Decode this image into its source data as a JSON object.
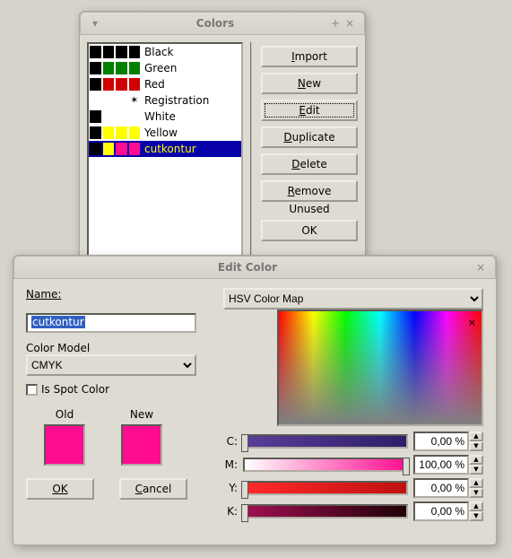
{
  "colors_window": {
    "title": "Colors",
    "buttons": {
      "import": "Import",
      "new": "New",
      "edit": "Edit",
      "duplicate": "Duplicate",
      "delete": "Delete",
      "remove_unused": "Remove Unused",
      "ok": "OK"
    },
    "items": [
      {
        "name": "Black",
        "swatches": [
          "#000000",
          "#000000",
          "#000000",
          "#000000"
        ]
      },
      {
        "name": "Green",
        "swatches": [
          "#000000",
          "#008000",
          "#008000",
          "#008000"
        ]
      },
      {
        "name": "Red",
        "swatches": [
          "#000000",
          "#d00000",
          "#d00000",
          "#d00000"
        ]
      },
      {
        "name": "Registration",
        "swatches": [
          "#ffffff",
          "#ffffff",
          "#ffffff",
          "reg"
        ]
      },
      {
        "name": "White",
        "swatches": [
          "#000000",
          "#ffffff",
          "#ffffff",
          "#ffffff"
        ]
      },
      {
        "name": "Yellow",
        "swatches": [
          "#000000",
          "#ffff00",
          "#ffff00",
          "#ffff00"
        ]
      },
      {
        "name": "cutkontur",
        "swatches": [
          "#000000",
          "#ffff00",
          "#ff0c90",
          "#ff0c90"
        ],
        "selected": true
      }
    ]
  },
  "edit_window": {
    "title": "Edit Color",
    "name_label": "Name:",
    "name_value": "cutkontur",
    "color_model_label": "Color Model",
    "color_model_value": "CMYK",
    "is_spot_label": "Is Spot Color",
    "map_label": "HSV Color Map",
    "old_label": "Old",
    "new_label": "New",
    "ok": "OK",
    "cancel": "Cancel",
    "channels": {
      "c": {
        "label": "C:",
        "value": "0,00 %",
        "pos": 0,
        "grad": "linear-gradient(to right,#5a3e98,#2e1e68)"
      },
      "m": {
        "label": "M:",
        "value": "100,00 %",
        "pos": 100,
        "grad": "linear-gradient(to right,#ffffff,#ff0c90)"
      },
      "y": {
        "label": "Y:",
        "value": "0,00 %",
        "pos": 0,
        "grad": "linear-gradient(to right,#ff2a2a,#c01010)"
      },
      "k": {
        "label": "K:",
        "value": "0,00 %",
        "pos": 0,
        "grad": "linear-gradient(to right,#a01050,#200008)"
      }
    }
  }
}
